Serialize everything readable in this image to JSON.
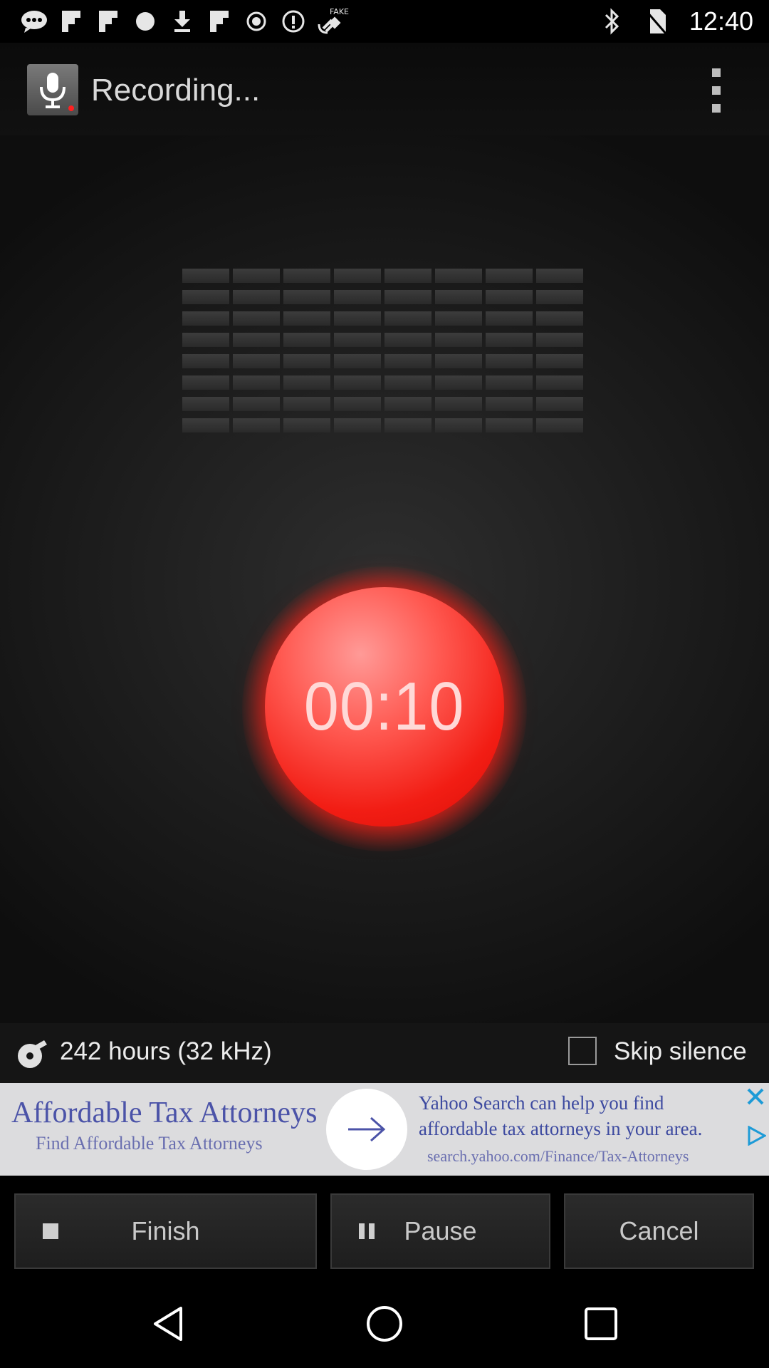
{
  "status_bar": {
    "time": "12:40",
    "left_icons": [
      "messenger-icon",
      "flipboard-icon",
      "flipboard-icon",
      "circle-icon",
      "download-icon",
      "flipboard-icon",
      "target-icon",
      "info-icon",
      "fake-gps-icon"
    ],
    "right_icons": [
      "bluetooth-icon",
      "no-sim-icon"
    ],
    "fake_gps_label": "FAKE"
  },
  "app_bar": {
    "title": "Recording..."
  },
  "meter": {
    "columns": 8,
    "segments_per_column": 8,
    "active_level": 0
  },
  "timer": {
    "elapsed": "00:10",
    "color": "#f21d14"
  },
  "info": {
    "storage_text": "242 hours (32 kHz)",
    "skip_silence_label": "Skip silence",
    "skip_silence_checked": false
  },
  "ad": {
    "headline": "Affordable Tax Attorneys",
    "subline": "Find Affordable Tax Attorneys",
    "description": "Yahoo Search can help you find affordable tax attorneys in your area.",
    "url": "search.yahoo.com/Finance/Tax-Attorneys"
  },
  "buttons": {
    "finish": "Finish",
    "pause": "Pause",
    "cancel": "Cancel"
  },
  "nav": {
    "back": "back-icon",
    "home": "home-icon",
    "recents": "recents-icon"
  }
}
